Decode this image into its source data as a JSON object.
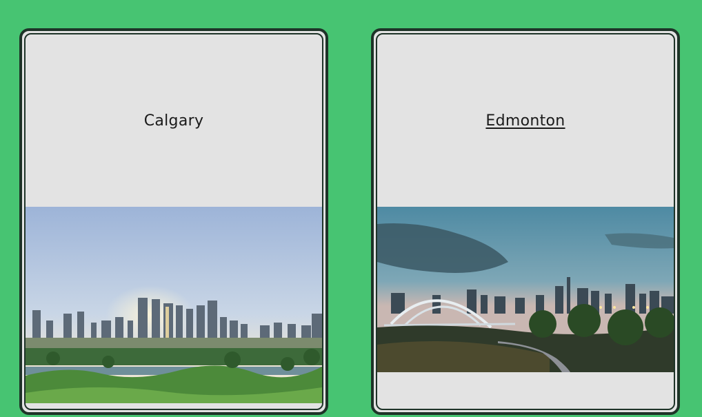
{
  "cities": [
    {
      "name": "Calgary",
      "image_alt": "Calgary skyline at sunrise over the Bow River"
    },
    {
      "name": "Edmonton",
      "image_alt": "Edmonton skyline with the Walterdale Bridge at dusk"
    }
  ]
}
